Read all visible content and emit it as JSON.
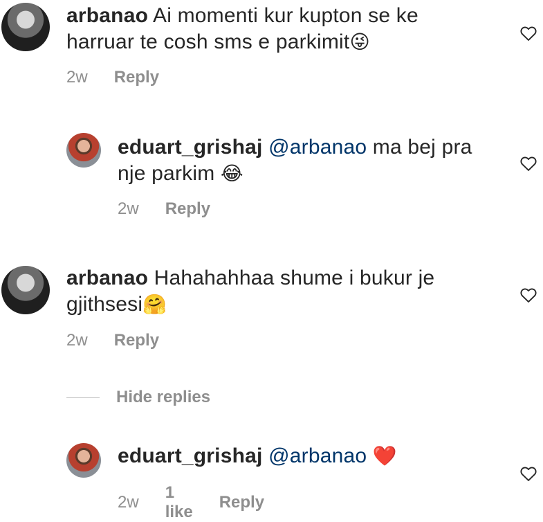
{
  "comments": [
    {
      "username": "arbanao",
      "text": " Ai momenti kur kupton se ke harruar te cosh sms e parkimit",
      "emoji": "😜",
      "time": "2w",
      "reply_label": "Reply"
    },
    {
      "username": "eduart_grishaj",
      "mention": "@arbanao",
      "text": " ma bej pra nje parkim ",
      "emoji": "😂",
      "time": "2w",
      "reply_label": "Reply"
    },
    {
      "username": "arbanao",
      "text": " Hahahahhaa shume i bukur je gjithsesi",
      "emoji": "🤗",
      "time": "2w",
      "reply_label": "Reply"
    },
    {
      "username": "eduart_grishaj",
      "mention": "@arbanao",
      "text": " ",
      "emoji": "❤️",
      "time": "2w",
      "likes_label": "1 like",
      "reply_label": "Reply"
    }
  ],
  "hide_replies_label": "Hide replies",
  "icons": {
    "like": "heart-outline-icon"
  },
  "colors": {
    "mention": "#003569",
    "meta": "#8e8e8e",
    "text": "#262626"
  }
}
